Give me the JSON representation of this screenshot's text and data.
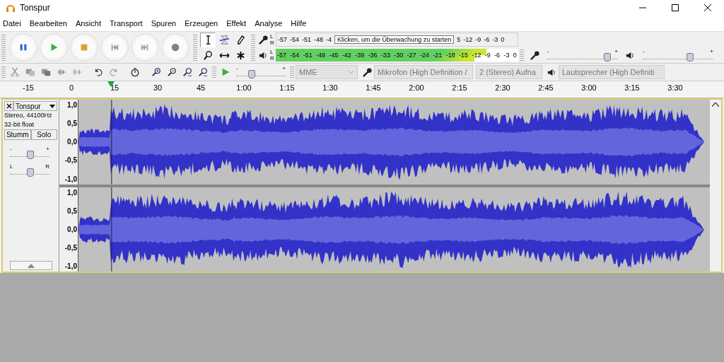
{
  "window": {
    "title": "Tonspur"
  },
  "menu": [
    "Datei",
    "Bearbeiten",
    "Ansicht",
    "Transport",
    "Spuren",
    "Erzeugen",
    "Effekt",
    "Analyse",
    "Hilfe"
  ],
  "tools": [
    {
      "kind": "select",
      "selected": true
    },
    {
      "kind": "envelope",
      "selected": false
    },
    {
      "kind": "draw",
      "selected": false
    },
    {
      "kind": "zoom",
      "selected": false
    },
    {
      "kind": "timeshift",
      "selected": false
    },
    {
      "kind": "multi",
      "selected": false
    }
  ],
  "record_meter": {
    "channels": [
      "L",
      "R"
    ],
    "scale": [
      "-57",
      "-54",
      "-51",
      "-48",
      "-4"
    ],
    "scale_end": [
      "5",
      "-12",
      "-9",
      "-6",
      "-3",
      "0"
    ],
    "tooltip": "Klicken, um die Überwachung zu starten"
  },
  "playback_meter": {
    "channels": [
      {
        "label": "L",
        "level": 0.87
      },
      {
        "label": "R",
        "level": 0.82
      }
    ],
    "scale": [
      "-57",
      "-54",
      "-51",
      "-48",
      "-45",
      "-42",
      "-39",
      "-36",
      "-33",
      "-30",
      "-27",
      "-24",
      "-21",
      "-18",
      "-15",
      "-12",
      "-9",
      "-6",
      "-3",
      "0"
    ]
  },
  "play_at_speed": {
    "min": "-",
    "max": "+",
    "level": 0.3
  },
  "devices": {
    "host": "MME",
    "input": "Mikrofon (High Definition /",
    "input_channels": "2 (Stereo) Aufna",
    "output": "Lautsprecher (High Definiti"
  },
  "mixer": {
    "input": {
      "min": "-",
      "max": "+",
      "level": 0.84
    },
    "output": {
      "min": "-",
      "max": "+",
      "level": 0.66
    }
  },
  "ruler": {
    "labels": [
      "-15",
      "0",
      "15",
      "30",
      "45",
      "1:00",
      "1:15",
      "1:30",
      "1:45",
      "2:00",
      "2:15",
      "2:30",
      "2:45",
      "3:00",
      "3:15",
      "3:30"
    ]
  },
  "track": {
    "name": "Tonspur",
    "info": [
      "Stereo, 44100Hz",
      "32-bit float"
    ],
    "mute": {
      "label": "Stumm",
      "selected": false
    },
    "solo": {
      "label": "Solo",
      "selected": false
    },
    "gain": {
      "min": "-",
      "max": "+",
      "level": 0.5
    },
    "pan": {
      "min": "L",
      "max": "R",
      "level": 0.5
    },
    "channels": [
      {
        "scale": [
          "1,0",
          "0,5",
          "0,0",
          "-0,5",
          "-1,0"
        ]
      },
      {
        "scale": [
          "1,0",
          "0,5",
          "0,0",
          "-0,5",
          "-1,0"
        ]
      }
    ]
  }
}
